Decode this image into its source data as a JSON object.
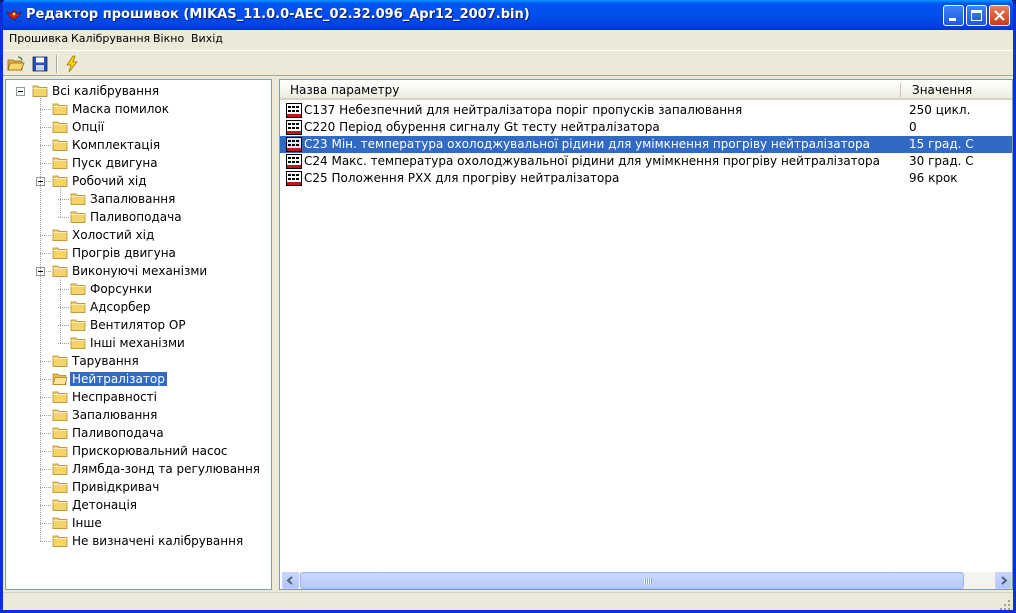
{
  "window": {
    "title": "Редактор прошивок (MIKAS_11.0.0-AEC_02.32.096_Apr12_2007.bin)",
    "app_icon": "eagle-app-icon",
    "controls": [
      "minimize-icon",
      "maximize-icon",
      "close-icon"
    ]
  },
  "menu": {
    "items": [
      {
        "label": "Прошивка"
      },
      {
        "label": "Калібрування"
      },
      {
        "label": "Вікно"
      },
      {
        "label": "Вихід"
      }
    ]
  },
  "toolbar": {
    "buttons": [
      "open-folder-icon",
      "save-disk-icon",
      "lightning-icon"
    ]
  },
  "tree": {
    "items": [
      {
        "label": "Всі калібрування",
        "level": 0,
        "expanded": true
      },
      {
        "label": "Маска помилок",
        "level": 1
      },
      {
        "label": "Опції",
        "level": 1
      },
      {
        "label": "Комплектація",
        "level": 1
      },
      {
        "label": "Пуск двигуна",
        "level": 1
      },
      {
        "label": "Робочий хід",
        "level": 1,
        "expanded": true
      },
      {
        "label": "Запалювання",
        "level": 2
      },
      {
        "label": "Паливоподача",
        "level": 2
      },
      {
        "label": "Холостий хід",
        "level": 1
      },
      {
        "label": "Прогрів двигуна",
        "level": 1
      },
      {
        "label": "Виконуючі механізми",
        "level": 1,
        "expanded": true
      },
      {
        "label": "Форсунки",
        "level": 2
      },
      {
        "label": "Адсорбер",
        "level": 2
      },
      {
        "label": "Вентилятор ОР",
        "level": 2
      },
      {
        "label": "Інші механізми",
        "level": 2
      },
      {
        "label": "Тарування",
        "level": 1
      },
      {
        "label": "Нейтралізатор",
        "level": 1,
        "selected": true
      },
      {
        "label": "Несправності",
        "level": 1
      },
      {
        "label": "Запалювання",
        "level": 1
      },
      {
        "label": "Паливоподача",
        "level": 1
      },
      {
        "label": "Прискорювальний насос",
        "level": 1
      },
      {
        "label": "Лямбда-зонд та регулювання",
        "level": 1
      },
      {
        "label": "Привідкривач",
        "level": 1
      },
      {
        "label": "Детонація",
        "level": 1
      },
      {
        "label": "Інше",
        "level": 1
      },
      {
        "label": "Не визначені калібрування",
        "level": 1
      }
    ]
  },
  "list": {
    "columns": {
      "name": "Назва параметру",
      "value": "Значення"
    },
    "rows": [
      {
        "name": "C137 Небезпечний для нейтралізатора поріг пропусків запалювання",
        "value": "250 цикл."
      },
      {
        "name": "C220 Період обурення сигналу Gt тесту нейтралізатора",
        "value": "0"
      },
      {
        "name": "C23 Мін. температура охолоджувальної рідини для умімкнення прогріву нейтралізатора",
        "value": "15 град. С",
        "selected": true
      },
      {
        "name": "C24 Макс. температура охолоджувальної рідини для умімкнення прогріву нейтралізатора",
        "value": "30 град. С"
      },
      {
        "name": "C25 Положення РХХ для прогріву нейтралізатора",
        "value": "96 крок"
      }
    ]
  },
  "colors": {
    "selection": "#316ac5",
    "titlebar": "#0053ee",
    "folder": "#f5d36b"
  }
}
